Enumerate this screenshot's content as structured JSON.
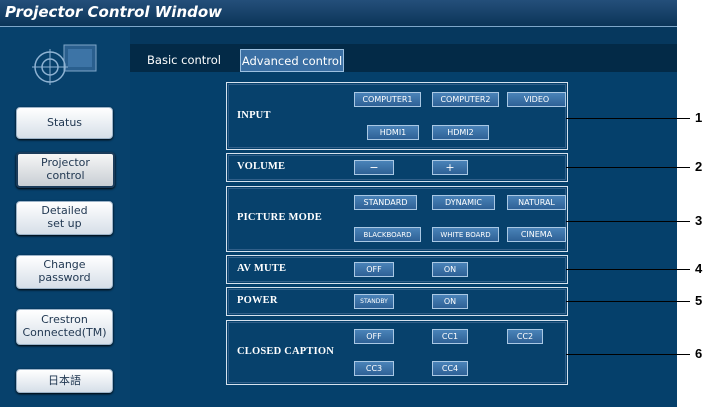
{
  "window": {
    "title": "Projector Control Window"
  },
  "sidebar": {
    "buttons": [
      {
        "label": "Status"
      },
      {
        "label": "Projector\ncontrol"
      },
      {
        "label": "Detailed\nset up"
      },
      {
        "label": "Change\npassword"
      },
      {
        "label": "Crestron\nConnected(TM)"
      },
      {
        "label": "日本語"
      }
    ],
    "active": "Projector\ncontrol"
  },
  "tabs": [
    {
      "label": "Basic control"
    },
    {
      "label": "Advanced control"
    }
  ],
  "controls": {
    "input": {
      "label": "INPUT",
      "buttons": [
        "COMPUTER1",
        "COMPUTER2",
        "VIDEO",
        "HDMI1",
        "HDMI2"
      ]
    },
    "volume": {
      "label": "VOLUME",
      "buttons": [
        "−",
        "+"
      ]
    },
    "picture_mode": {
      "label": "PICTURE MODE",
      "buttons": [
        "STANDARD",
        "DYNAMIC",
        "NATURAL",
        "BLACKBOARD",
        "WHITE BOARD",
        "CINEMA"
      ]
    },
    "av_mute": {
      "label": "AV MUTE",
      "buttons": [
        "OFF",
        "ON"
      ]
    },
    "power": {
      "label": "POWER",
      "buttons": [
        "STANDBY",
        "ON"
      ]
    },
    "closed_caption": {
      "label": "CLOSED CAPTION",
      "buttons": [
        "OFF",
        "CC1",
        "CC2",
        "CC3",
        "CC4"
      ]
    }
  },
  "callouts": [
    "1",
    "2",
    "3",
    "4",
    "5",
    "6"
  ],
  "colors": {
    "window_bg": "#06385e",
    "button_blue": "#3a72a8",
    "label_white": "#ffffff"
  }
}
